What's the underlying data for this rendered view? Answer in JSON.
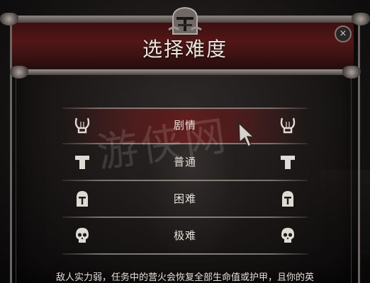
{
  "dialog": {
    "title": "选择难度",
    "close_label": "×"
  },
  "difficulty_options": [
    {
      "label": "剧情",
      "icon": "lyre-icon",
      "selected": true
    },
    {
      "label": "普通",
      "icon": "shield-icon",
      "selected": false
    },
    {
      "label": "困难",
      "icon": "knight-helmet-icon",
      "selected": false
    },
    {
      "label": "极难",
      "icon": "skull-icon",
      "selected": false
    }
  ],
  "description": "敌人实力弱，任务中的营火会恢复全部生命值或护甲，且你的英",
  "watermark": "游侠网",
  "colors": {
    "header_red": "#521717",
    "selected_red": "#781a1a",
    "text": "#ece6df",
    "frame_metal": "#8d8681"
  }
}
